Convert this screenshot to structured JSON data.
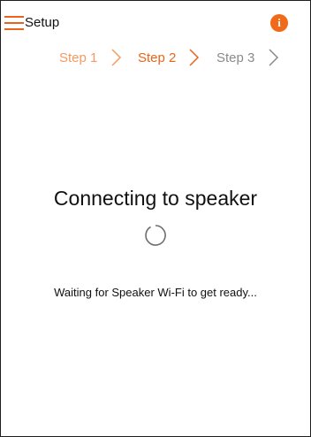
{
  "header": {
    "title": "Setup",
    "info_icon": "i"
  },
  "steps": [
    {
      "label": "Step 1",
      "color": "#f39a63"
    },
    {
      "label": "Step 2",
      "color": "#e8641b"
    },
    {
      "label": "Step 3",
      "color": "#8a8a8a"
    }
  ],
  "main": {
    "title": "Connecting to speaker",
    "status": "Waiting for Speaker Wi-Fi to get ready..."
  },
  "colors": {
    "accent": "#e8641b",
    "muted": "#8a8a8a"
  }
}
